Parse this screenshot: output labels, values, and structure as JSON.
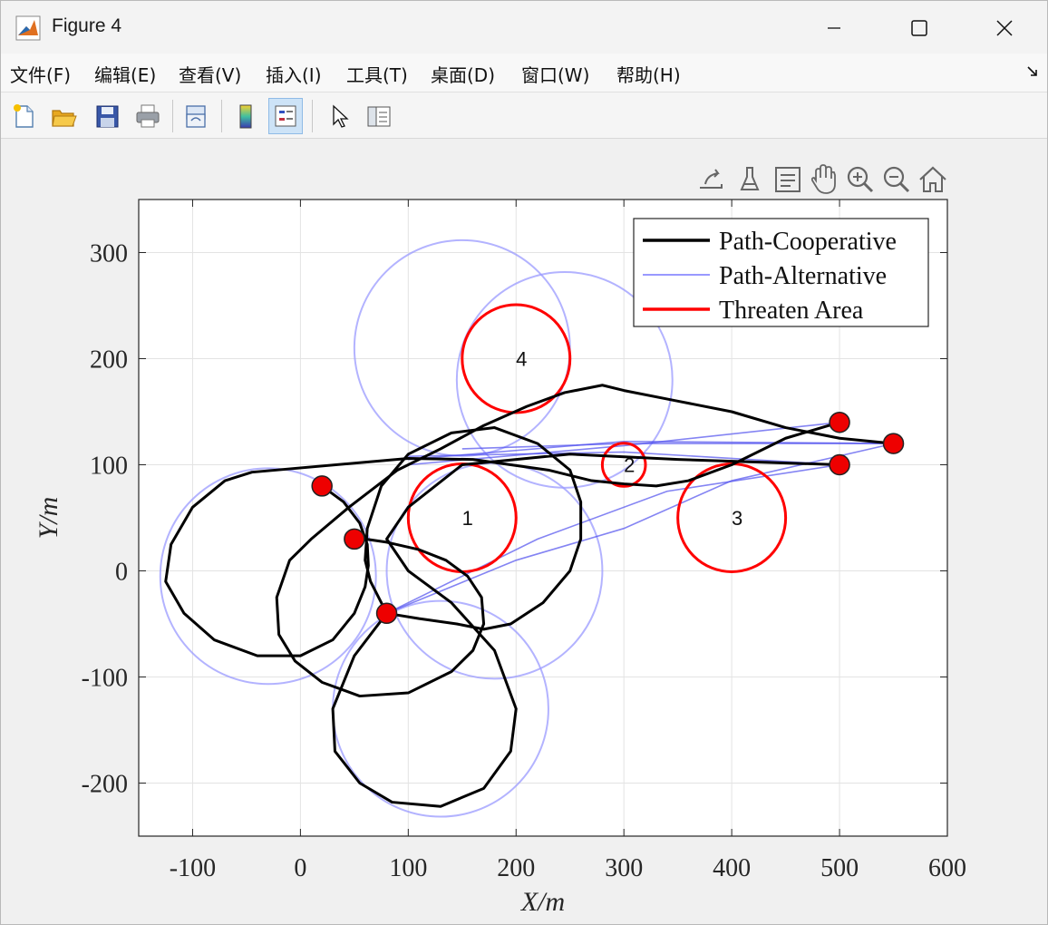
{
  "window": {
    "title": "Figure 4",
    "minimize_icon": "minimize-icon",
    "maximize_icon": "maximize-icon",
    "close_icon": "close-icon"
  },
  "menu": [
    {
      "label": "文件(F)"
    },
    {
      "label": "编辑(E)"
    },
    {
      "label": "查看(V)"
    },
    {
      "label": "插入(I)"
    },
    {
      "label": "工具(T)"
    },
    {
      "label": "桌面(D)"
    },
    {
      "label": "窗口(W)"
    },
    {
      "label": "帮助(H)"
    }
  ],
  "toolbar": {
    "icons": [
      "new-figure-icon",
      "open-file-icon",
      "save-icon",
      "print-icon",
      "link-plot-icon",
      "colorbar-icon",
      "legend-icon",
      "edit-plot-icon",
      "property-inspector-icon"
    ]
  },
  "axes_toolbar": {
    "icons": [
      "export-icon",
      "brush-icon",
      "datatip-icon",
      "pan-icon",
      "zoom-in-icon",
      "zoom-out-icon",
      "home-icon"
    ]
  },
  "chart_data": {
    "type": "line",
    "xlabel": "X/m",
    "ylabel": "Y/m",
    "xlim": [
      -150,
      600
    ],
    "ylim": [
      -250,
      350
    ],
    "xticks": [
      "-100",
      "0",
      "100",
      "200",
      "300",
      "400",
      "500",
      "600"
    ],
    "yticks": [
      "-200",
      "-100",
      "0",
      "100",
      "200",
      "300"
    ],
    "grid": true,
    "legend_position": "top-right",
    "legend": [
      {
        "name": "Path-Cooperative",
        "color": "#000000"
      },
      {
        "name": "Path-Alternative",
        "color": "#9999ff"
      },
      {
        "name": "Threaten Area",
        "color": "#ff0000"
      }
    ],
    "threat_areas": [
      {
        "label": "1",
        "cx": 150,
        "cy": 50,
        "r": 50
      },
      {
        "label": "2",
        "cx": 300,
        "cy": 100,
        "r": 20
      },
      {
        "label": "3",
        "cx": 400,
        "cy": 50,
        "r": 50
      },
      {
        "label": "4",
        "cx": 200,
        "cy": 200,
        "r": 50
      }
    ],
    "start_points": [
      {
        "x": 20,
        "y": 80
      },
      {
        "x": 50,
        "y": 30
      },
      {
        "x": 80,
        "y": -40
      }
    ],
    "goal_points": [
      {
        "x": 500,
        "y": 140
      },
      {
        "x": 550,
        "y": 120
      },
      {
        "x": 500,
        "y": 100
      }
    ],
    "cooperative_paths": [
      [
        [
          20,
          80
        ],
        [
          40,
          65
        ],
        [
          55,
          45
        ],
        [
          62,
          25
        ],
        [
          63,
          5
        ],
        [
          60,
          -15
        ],
        [
          50,
          -40
        ],
        [
          30,
          -65
        ],
        [
          0,
          -80
        ],
        [
          -40,
          -80
        ],
        [
          -80,
          -65
        ],
        [
          -108,
          -40
        ],
        [
          -125,
          -10
        ],
        [
          -120,
          25
        ],
        [
          -100,
          60
        ],
        [
          -70,
          85
        ],
        [
          -45,
          93
        ],
        [
          100,
          106
        ],
        [
          160,
          105
        ],
        [
          195,
          100
        ],
        [
          230,
          95
        ],
        [
          270,
          85
        ],
        [
          300,
          82
        ],
        [
          330,
          80
        ],
        [
          360,
          85
        ],
        [
          400,
          100
        ],
        [
          450,
          125
        ],
        [
          500,
          140
        ]
      ],
      [
        [
          50,
          30
        ],
        [
          60,
          30
        ],
        [
          80,
          27
        ],
        [
          110,
          20
        ],
        [
          135,
          10
        ],
        [
          155,
          -5
        ],
        [
          168,
          -25
        ],
        [
          170,
          -50
        ],
        [
          160,
          -75
        ],
        [
          140,
          -95
        ],
        [
          100,
          -115
        ],
        [
          55,
          -118
        ],
        [
          20,
          -105
        ],
        [
          -5,
          -85
        ],
        [
          -20,
          -60
        ],
        [
          -22,
          -25
        ],
        [
          -10,
          10
        ],
        [
          10,
          30
        ],
        [
          45,
          60
        ],
        [
          90,
          95
        ],
        [
          130,
          115
        ],
        [
          170,
          137
        ],
        [
          210,
          155
        ],
        [
          245,
          168
        ],
        [
          280,
          175
        ],
        [
          300,
          170
        ],
        [
          350,
          160
        ],
        [
          400,
          150
        ],
        [
          450,
          135
        ],
        [
          500,
          125
        ],
        [
          550,
          120
        ]
      ],
      [
        [
          80,
          -40
        ],
        [
          75,
          -30
        ],
        [
          65,
          -10
        ],
        [
          60,
          10
        ],
        [
          62,
          40
        ],
        [
          75,
          80
        ],
        [
          100,
          110
        ],
        [
          140,
          130
        ],
        [
          180,
          135
        ],
        [
          220,
          120
        ],
        [
          250,
          95
        ],
        [
          260,
          65
        ],
        [
          260,
          30
        ],
        [
          250,
          0
        ],
        [
          225,
          -30
        ],
        [
          195,
          -50
        ],
        [
          170,
          -55
        ],
        [
          145,
          -50
        ],
        [
          110,
          -45
        ],
        [
          80,
          -40
        ],
        [
          50,
          -80
        ],
        [
          30,
          -130
        ],
        [
          32,
          -170
        ],
        [
          55,
          -200
        ],
        [
          85,
          -218
        ],
        [
          130,
          -222
        ],
        [
          170,
          -205
        ],
        [
          195,
          -170
        ],
        [
          200,
          -130
        ],
        [
          180,
          -75
        ],
        [
          140,
          -30
        ],
        [
          100,
          0
        ],
        [
          80,
          30
        ],
        [
          100,
          60
        ],
        [
          150,
          100
        ],
        [
          250,
          110
        ],
        [
          350,
          105
        ],
        [
          500,
          100
        ]
      ]
    ],
    "alternative_paths_count": 6
  }
}
